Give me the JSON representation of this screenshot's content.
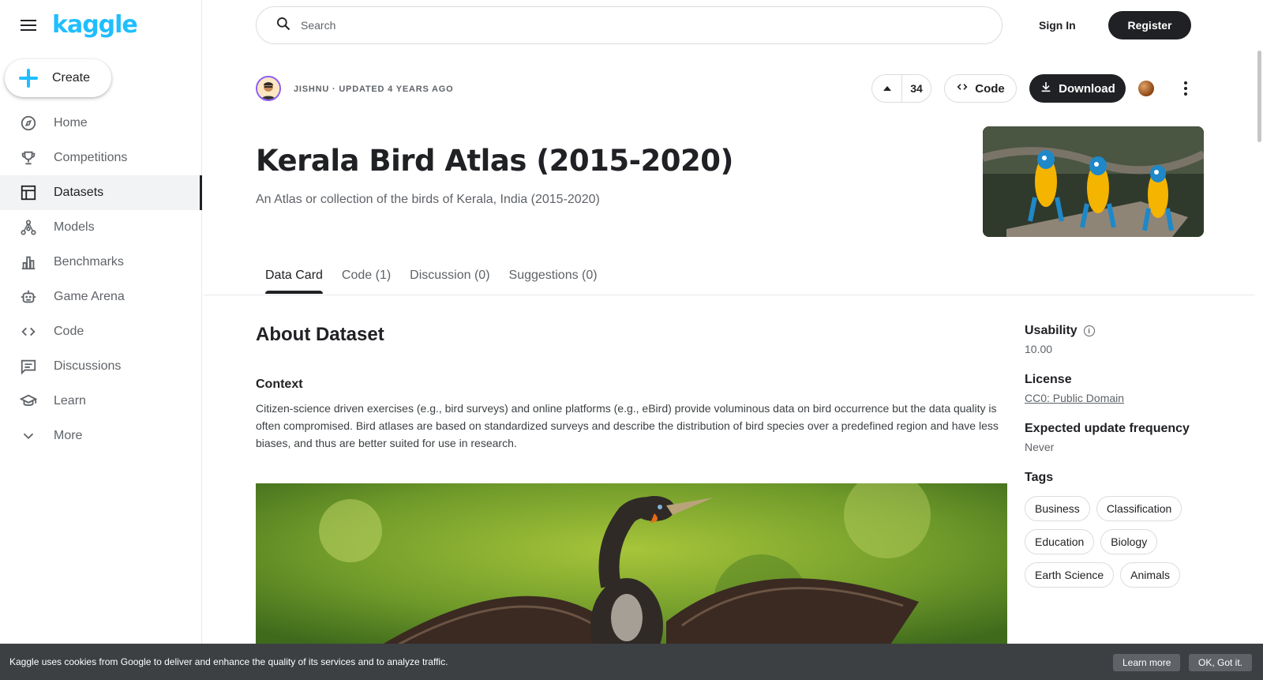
{
  "sidebar": {
    "logo": "kaggle",
    "create_label": "Create",
    "items": [
      {
        "label": "Home",
        "icon": "compass-icon"
      },
      {
        "label": "Competitions",
        "icon": "trophy-icon"
      },
      {
        "label": "Datasets",
        "icon": "table-icon",
        "active": true
      },
      {
        "label": "Models",
        "icon": "models-icon"
      },
      {
        "label": "Benchmarks",
        "icon": "bar-chart-icon"
      },
      {
        "label": "Game Arena",
        "icon": "robot-icon"
      },
      {
        "label": "Code",
        "icon": "code-icon"
      },
      {
        "label": "Discussions",
        "icon": "comment-icon"
      },
      {
        "label": "Learn",
        "icon": "school-icon"
      },
      {
        "label": "More",
        "icon": "chevron-down-icon"
      }
    ]
  },
  "header": {
    "search_placeholder": "Search",
    "signin_label": "Sign In",
    "register_label": "Register"
  },
  "dataset": {
    "author_line": "JISHNU · UPDATED 4 YEARS AGO",
    "votes": "34",
    "code_label": "Code",
    "download_label": "Download",
    "title": "Kerala Bird Atlas (2015-2020)",
    "subtitle": "An Atlas or collection of the birds of Kerala, India (2015-2020)"
  },
  "tabs": [
    "Data Card",
    "Code (1)",
    "Discussion (0)",
    "Suggestions (0)"
  ],
  "content": {
    "about_heading": "About Dataset",
    "context_heading": "Context",
    "context_text": "Citizen-science driven exercises (e.g., bird surveys) and online platforms (e.g., eBird) provide voluminous data on bird occurrence but the data quality is often compromised. Bird atlases are based on standardized surveys and describe the distribution of bird species over a predefined region and have less biases, and thus are better suited for use in research."
  },
  "meta": {
    "usability_label": "Usability",
    "usability_value": "10.00",
    "license_label": "License",
    "license_value": "CC0: Public Domain",
    "frequency_label": "Expected update frequency",
    "frequency_value": "Never",
    "tags_label": "Tags",
    "tags": [
      "Business",
      "Classification",
      "Education",
      "Biology",
      "Earth Science",
      "Animals"
    ]
  },
  "cookie": {
    "message": "Kaggle uses cookies from Google to deliver and enhance the quality of its services and to analyze traffic.",
    "learn_more": "Learn more",
    "ok": "OK, Got it."
  },
  "colors": {
    "brand": "#20beff",
    "dark": "#202124",
    "muted": "#5f6368",
    "border": "#dadce0"
  }
}
